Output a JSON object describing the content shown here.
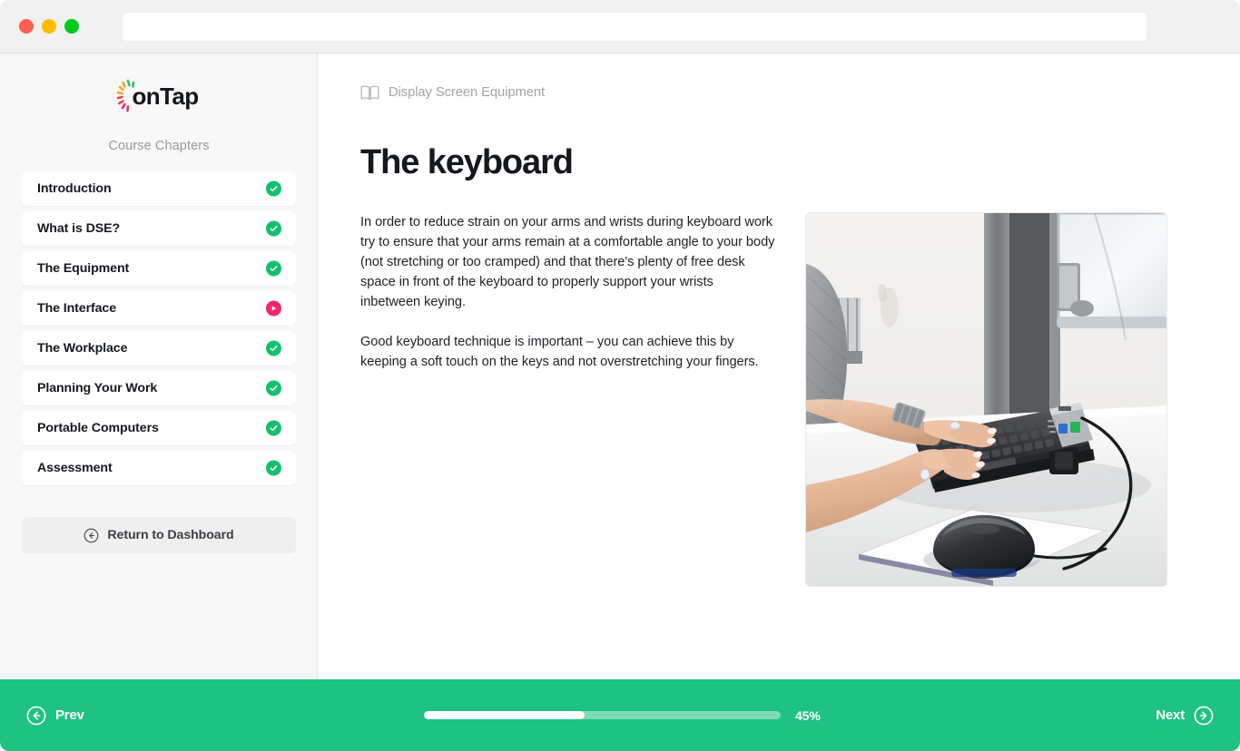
{
  "window": {
    "traffic_lights": [
      "close",
      "minimize",
      "maximize"
    ],
    "url_value": "",
    "url_placeholder": ""
  },
  "sidebar": {
    "logo_text": "onTap",
    "section_label": "Course Chapters",
    "chapters": [
      {
        "label": "Introduction",
        "status": "complete"
      },
      {
        "label": "What is DSE?",
        "status": "complete"
      },
      {
        "label": "The Equipment",
        "status": "complete"
      },
      {
        "label": "The Interface",
        "status": "active"
      },
      {
        "label": "The Workplace",
        "status": "complete"
      },
      {
        "label": "Planning Your Work",
        "status": "complete"
      },
      {
        "label": "Portable Computers",
        "status": "complete"
      },
      {
        "label": "Assessment",
        "status": "complete"
      }
    ],
    "return_label": "Return to Dashboard",
    "return_icon": "arrow-left-circle-icon"
  },
  "main": {
    "breadcrumb_icon": "book-icon",
    "breadcrumb": "Display Screen Equipment",
    "title": "The keyboard",
    "paragraphs": [
      "In order to reduce strain on your arms and wrists during keyboard work try to ensure that your arms remain at a comfortable angle to your body (not stretching or too cramped) and that there's plenty of free desk space in front of the keyboard to properly support your wrists inbetween keying.",
      "Good keyboard technique is important – you can achieve this by keeping a soft touch on the keys and not overstretching your fingers."
    ],
    "photo_alt": "Person typing on a keyboard at a desk with a mouse on a mousepad"
  },
  "bottom_nav": {
    "prev_label": "Prev",
    "prev_icon": "arrow-left-circle-icon",
    "next_label": "Next",
    "next_icon": "arrow-right-circle-icon",
    "progress_percent_label": "45%",
    "progress_value": 45
  },
  "colors": {
    "accent_green": "#1ec281",
    "badge_complete": "#11c06f",
    "badge_active": "#ef2768",
    "sidebar_bg": "#f8f8f8",
    "text_dark": "#15181c",
    "text_muted": "#9a9a9a"
  }
}
